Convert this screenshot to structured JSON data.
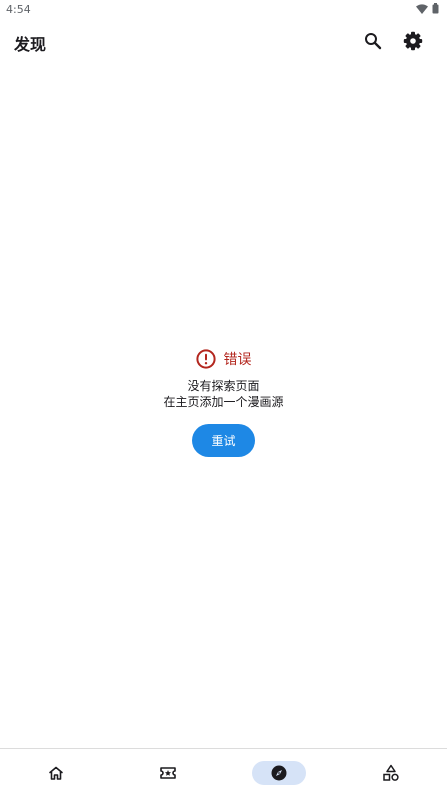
{
  "status_bar": {
    "time": "4:54"
  },
  "app_bar": {
    "title": "发现"
  },
  "error": {
    "title": "错误",
    "message_line1": "没有探索页面",
    "message_line2": "在主页添加一个漫画源",
    "retry_label": "重试"
  },
  "colors": {
    "accent": "#1e88e5",
    "error": "#b3261e",
    "nav_indicator": "#d6e3f7"
  },
  "bottom_nav": {
    "items": [
      {
        "icon": "home-icon",
        "selected": false
      },
      {
        "icon": "ticket-star-icon",
        "selected": false
      },
      {
        "icon": "compass-icon",
        "selected": true
      },
      {
        "icon": "shapes-icon",
        "selected": false
      }
    ]
  }
}
